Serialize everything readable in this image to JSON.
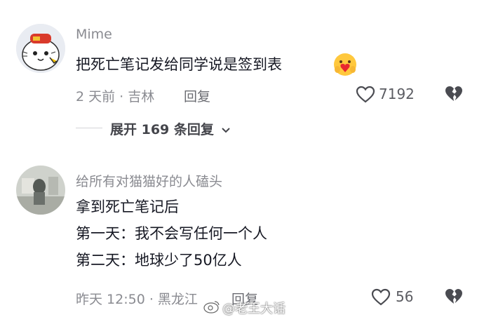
{
  "comments": [
    {
      "username": "Mime",
      "text_lines": [
        "把死亡笔记发给同学说是签到表"
      ],
      "emoji": "heart-hands-emoji",
      "meta": "2 天前 · 吉林",
      "reply_label": "回复",
      "likes": "7192",
      "expand_label": "展开 169 条回复"
    },
    {
      "username": "给所有对猫猫好的人磕头",
      "text_lines": [
        "拿到死亡笔记后",
        "第一天：我不会写任何一个人",
        "第二天：地球少了50亿人"
      ],
      "meta": "昨天 12:50 · 黑龙江",
      "reply_label": "回复",
      "likes": "56"
    }
  ],
  "watermark": "@老王大话",
  "colors": {
    "text": "#161823",
    "secondary": "#8a8b91",
    "icon": "#4a4b51"
  }
}
